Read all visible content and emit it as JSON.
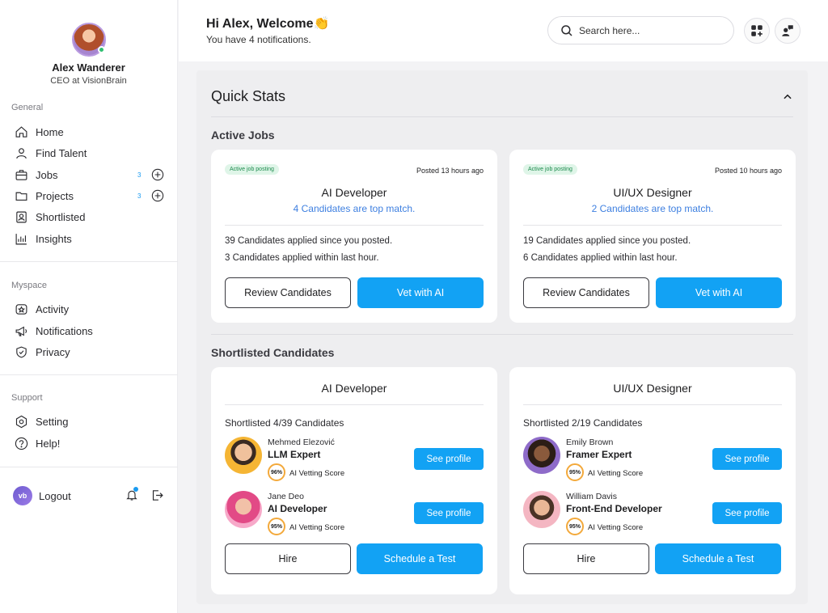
{
  "user": {
    "name": "Alex Wanderer",
    "role": "CEO at VisionBrain"
  },
  "sidebar": {
    "general_label": "General",
    "general_items": [
      {
        "label": "Home",
        "icon": "home-icon"
      },
      {
        "label": "Find Talent",
        "icon": "user-icon"
      },
      {
        "label": "Jobs",
        "icon": "briefcase-icon",
        "count": "3"
      },
      {
        "label": "Projects",
        "icon": "folder-icon",
        "count": "3"
      },
      {
        "label": "Shortlisted",
        "icon": "id-badge-icon"
      },
      {
        "label": "Insights",
        "icon": "chart-icon"
      }
    ],
    "myspace_label": "Myspace",
    "myspace_items": [
      {
        "label": "Activity",
        "icon": "activity-icon"
      },
      {
        "label": "Notifications",
        "icon": "megaphone-icon"
      },
      {
        "label": "Privacy",
        "icon": "shield-icon"
      }
    ],
    "support_label": "Support",
    "support_items": [
      {
        "label": "Setting",
        "icon": "gear-icon"
      },
      {
        "label": "Help!",
        "icon": "help-icon"
      }
    ],
    "logo_text": "vb",
    "logout_label": "Logout"
  },
  "header": {
    "greeting": "Hi Alex, Welcome👏",
    "subtitle": "You have 4 notifications.",
    "search_placeholder": "Search here..."
  },
  "quick_stats": {
    "title": "Quick Stats",
    "active_jobs_label": "Active Jobs",
    "jobs": [
      {
        "badge": "Active job posting",
        "posted": "Posted 13 hours ago",
        "title": "AI Developer",
        "match": "4 Candidates are top match.",
        "applied_since": "39 Candidates applied since you posted.",
        "applied_hour": "3 Candidates applied within last hour.",
        "review_label": "Review Candidates",
        "vet_label": "Vet with AI"
      },
      {
        "badge": "Active job posting",
        "posted": "Posted 10 hours ago",
        "title": "UI/UX Designer",
        "match": "2 Candidates are top match.",
        "applied_since": "19 Candidates applied since you posted.",
        "applied_hour": "6 Candidates applied within last hour.",
        "review_label": "Review Candidates",
        "vet_label": "Vet with AI"
      }
    ],
    "shortlisted_label": "Shortlisted Candidates",
    "shortlists": [
      {
        "title": "AI Developer",
        "summary": "Shortlisted 4/39 Candidates",
        "candidates": [
          {
            "name": "Mehmed Elezović",
            "role": "LLM Expert",
            "score": "96%",
            "score_label": "AI Vetting Score",
            "button": "See profile"
          },
          {
            "name": "Jane Deo",
            "role": "AI Developer",
            "score": "95%",
            "score_label": "AI Vetting Score",
            "button": "See profile"
          }
        ],
        "hire_label": "Hire",
        "test_label": "Schedule a Test"
      },
      {
        "title": "UI/UX Designer",
        "summary": "Shortlisted 2/19 Candidates",
        "candidates": [
          {
            "name": "Emily Brown",
            "role": "Framer Expert",
            "score": "95%",
            "score_label": "AI Vetting Score",
            "button": "See profile"
          },
          {
            "name": "William Davis",
            "role": "Front-End Developer",
            "score": "95%",
            "score_label": "AI Vetting Score",
            "button": "See profile"
          }
        ],
        "hire_label": "Hire",
        "test_label": "Schedule a Test"
      }
    ]
  },
  "colors": {
    "accent": "#12a2f4",
    "match_text": "#3d7fe0",
    "badge_bg": "#dff5e8",
    "badge_text": "#1b8a4c"
  }
}
